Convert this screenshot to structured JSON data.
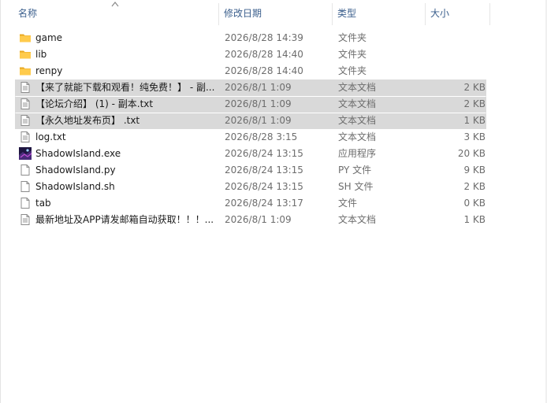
{
  "columns": {
    "name": "名称",
    "date": "修改日期",
    "type": "类型",
    "size": "大小"
  },
  "files": [
    {
      "name": "game",
      "date": "2026/8/28 14:39",
      "type": "文件夹",
      "size": "",
      "icon": "folder-icon",
      "selected": false
    },
    {
      "name": "lib",
      "date": "2026/8/28 14:40",
      "type": "文件夹",
      "size": "",
      "icon": "folder-icon",
      "selected": false
    },
    {
      "name": "renpy",
      "date": "2026/8/28 14:40",
      "type": "文件夹",
      "size": "",
      "icon": "folder-icon",
      "selected": false
    },
    {
      "name": "【来了就能下载和观看！纯免费！】 - 副...",
      "date": "2026/8/1 1:09",
      "type": "文本文档",
      "size": "2 KB",
      "icon": "text-file-icon",
      "selected": true
    },
    {
      "name": "【论坛介绍】 (1) - 副本.txt",
      "date": "2026/8/1 1:09",
      "type": "文本文档",
      "size": "2 KB",
      "icon": "text-file-icon",
      "selected": true
    },
    {
      "name": "【永久地址发布页】 .txt",
      "date": "2026/8/1 1:09",
      "type": "文本文档",
      "size": "1 KB",
      "icon": "text-file-icon",
      "selected": true
    },
    {
      "name": "log.txt",
      "date": "2026/8/28 3:15",
      "type": "文本文档",
      "size": "3 KB",
      "icon": "text-file-icon",
      "selected": false
    },
    {
      "name": "ShadowIsland.exe",
      "date": "2026/8/24 13:15",
      "type": "应用程序",
      "size": "20 KB",
      "icon": "app-icon",
      "selected": false
    },
    {
      "name": "ShadowIsland.py",
      "date": "2026/8/24 13:15",
      "type": "PY 文件",
      "size": "9 KB",
      "icon": "blank-file-icon",
      "selected": false
    },
    {
      "name": "ShadowIsland.sh",
      "date": "2026/8/24 13:15",
      "type": "SH 文件",
      "size": "2 KB",
      "icon": "blank-file-icon",
      "selected": false
    },
    {
      "name": "tab",
      "date": "2026/8/24 13:17",
      "type": "文件",
      "size": "0 KB",
      "icon": "blank-file-icon",
      "selected": false
    },
    {
      "name": "最新地址及APP请发邮箱自动获取！！！...",
      "date": "2026/8/1 1:09",
      "type": "文本文档",
      "size": "1 KB",
      "icon": "text-file-icon",
      "selected": false
    }
  ],
  "colors": {
    "header_text": "#3a5e8c",
    "selection": "#d9d9d9",
    "folder": "#ffcb4c",
    "folder_dark": "#e8a822"
  }
}
